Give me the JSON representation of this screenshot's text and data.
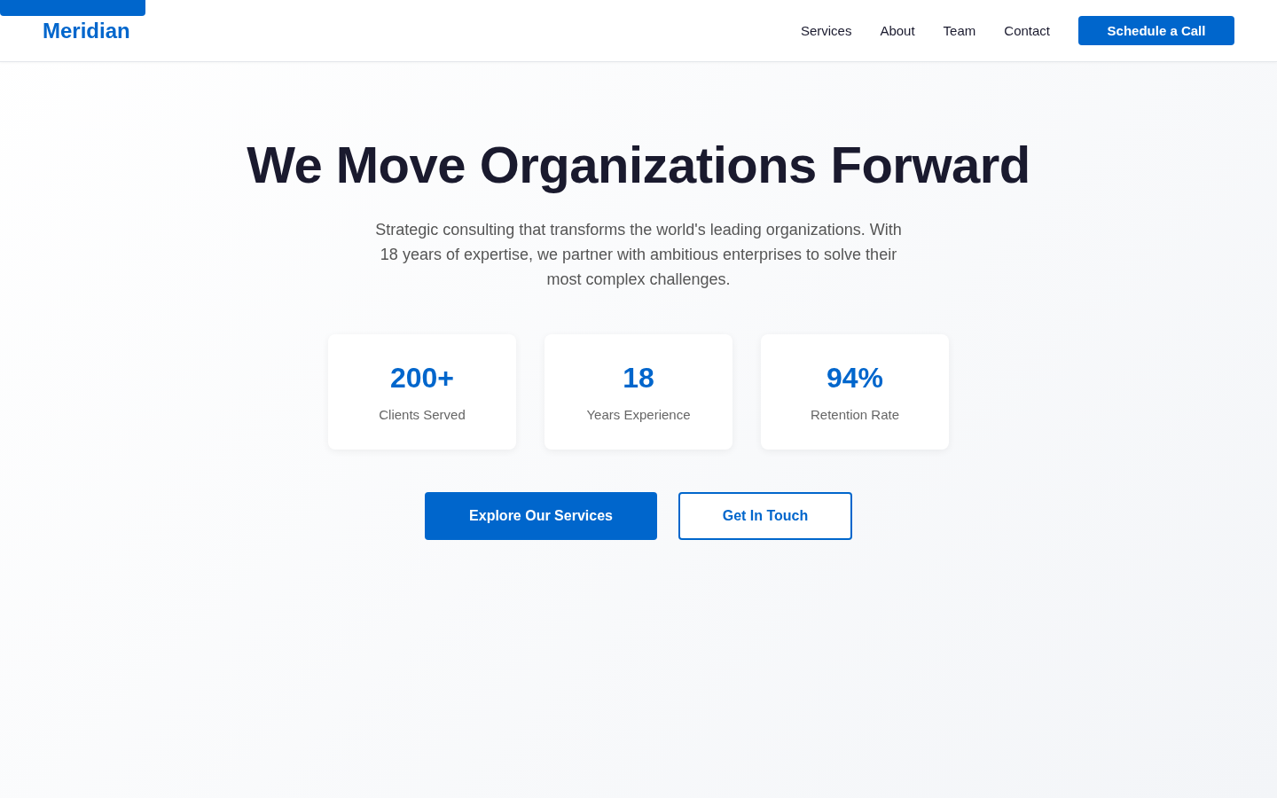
{
  "brand": "Meridian",
  "nav": {
    "links": [
      "Services",
      "About",
      "Team",
      "Contact"
    ],
    "cta": "Schedule a Call"
  },
  "hero": {
    "title": "We Move Organizations Forward",
    "subtitle": "Strategic consulting that transforms the world's leading organizations. With 18 years of expertise, we partner with ambitious enterprises to solve their most complex challenges."
  },
  "stats": [
    {
      "value": "200+",
      "label": "Clients Served"
    },
    {
      "value": "18",
      "label": "Years Experience"
    },
    {
      "value": "94%",
      "label": "Retention Rate"
    }
  ],
  "actions": [
    {
      "label": "Explore Our Services",
      "kind": "primary"
    },
    {
      "label": "Get In Touch",
      "kind": "outline"
    }
  ]
}
